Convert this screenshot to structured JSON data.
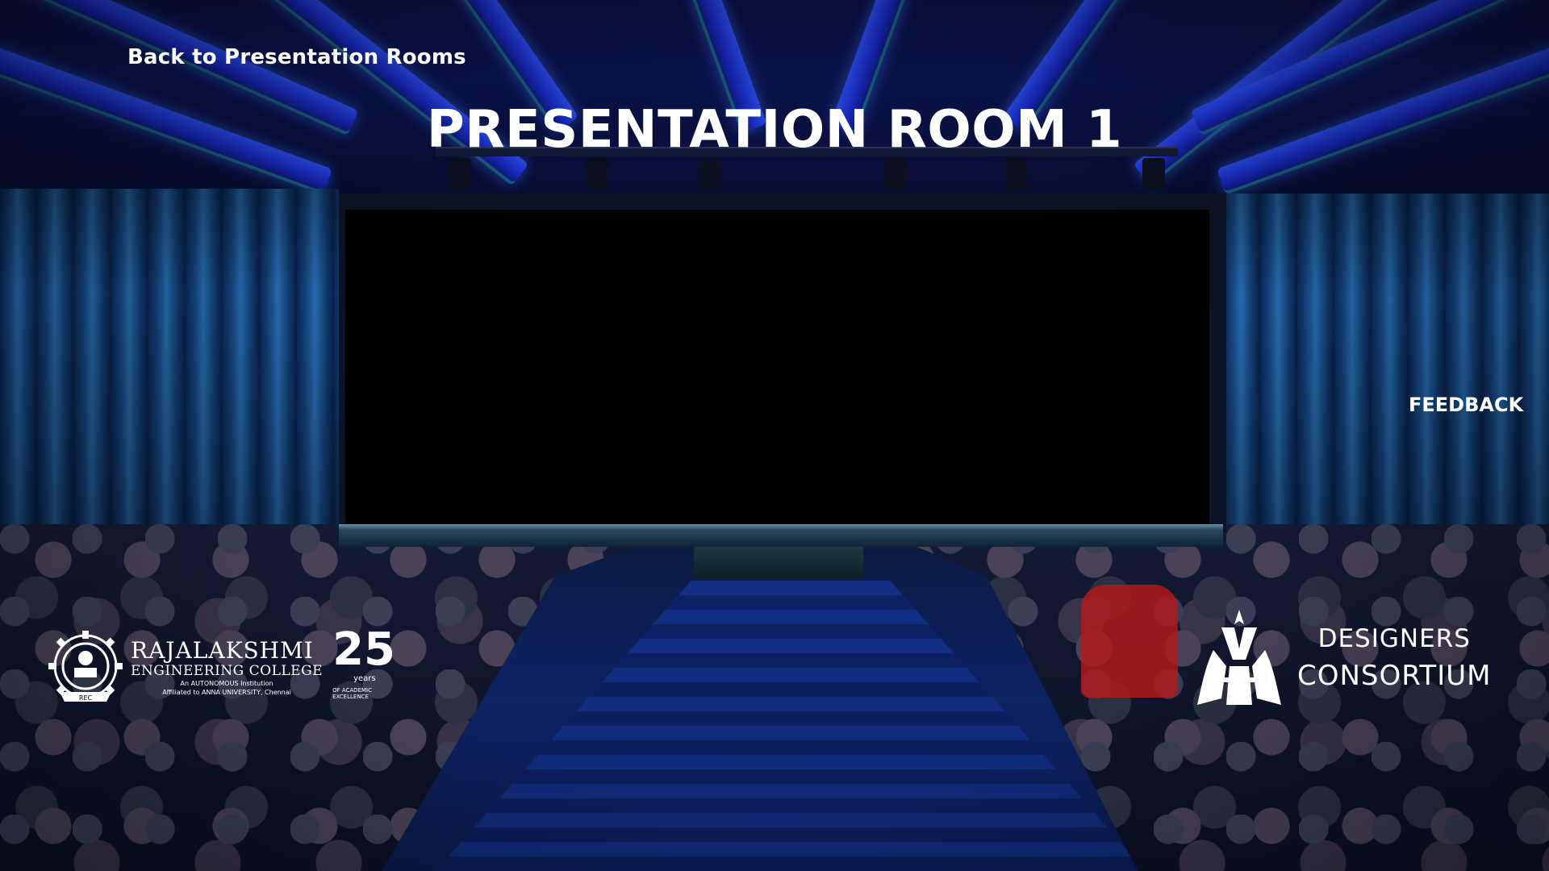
{
  "nav": {
    "back_label": "Back to Presentation Rooms",
    "feedback_label": "FEEDBACK"
  },
  "room": {
    "title": "PRESENTATION ROOM 1"
  },
  "sponsors": {
    "college": {
      "name": "RAJALAKSHMI",
      "subtitle": "ENGINEERING COLLEGE",
      "tagline_1": "An AUTONOMOUS Institution",
      "tagline_2": "Affiliated to ANNA UNIVERSITY, Chennai",
      "anniversary_number": "25",
      "anniversary_unit": "years",
      "anniversary_caption": "OF ACADEMIC EXCELLENCE",
      "seal_text": "REC"
    },
    "consortium": {
      "line_1": "DESIGNERS",
      "line_2": "CONSORTIUM"
    }
  },
  "colors": {
    "overlay_text": "#ffffff",
    "ceiling_light": "#2e52ff",
    "curtain": "#1d4f88",
    "screen": "#000000"
  }
}
